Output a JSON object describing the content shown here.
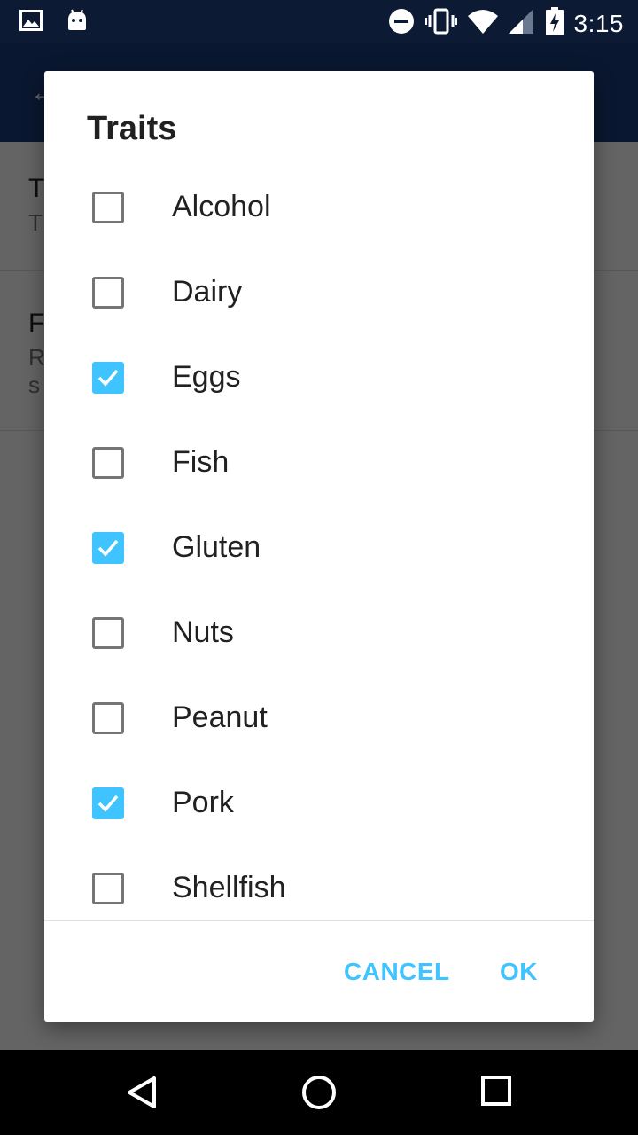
{
  "status_bar": {
    "time": "3:15",
    "icons_left": [
      "image-icon",
      "android-icon"
    ],
    "icons_right": [
      "do-not-disturb-icon",
      "vibrate-icon",
      "wifi-icon",
      "signal-icon",
      "battery-charging-icon"
    ]
  },
  "dialog": {
    "title": "Traits",
    "options": [
      {
        "label": "Alcohol",
        "checked": false
      },
      {
        "label": "Dairy",
        "checked": false
      },
      {
        "label": "Eggs",
        "checked": true
      },
      {
        "label": "Fish",
        "checked": false
      },
      {
        "label": "Gluten",
        "checked": true
      },
      {
        "label": "Nuts",
        "checked": false
      },
      {
        "label": "Peanut",
        "checked": false
      },
      {
        "label": "Pork",
        "checked": true
      },
      {
        "label": "Shellfish",
        "checked": false
      }
    ],
    "cancel_label": "CANCEL",
    "ok_label": "OK"
  },
  "background": {
    "pref1_title": "T",
    "pref1_summary": "T",
    "pref2_title": "F",
    "pref2_summary_line1": "R",
    "pref2_summary_line2": "s"
  },
  "colors": {
    "accent": "#40c4ff",
    "app_bar": "#1a3a78",
    "status_bar": "#0d1a33"
  },
  "nav_bar": {
    "icons": [
      "back-icon",
      "home-icon",
      "recents-icon"
    ]
  }
}
